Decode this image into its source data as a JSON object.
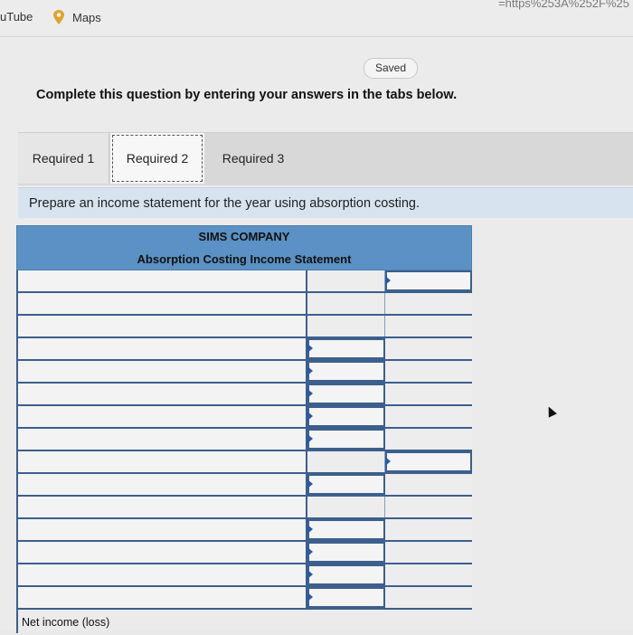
{
  "browser": {
    "url_fragment": "=https%253A%252F%25",
    "bookmarks": [
      {
        "label": "uTube",
        "icon": "youtube"
      },
      {
        "label": "Maps",
        "icon": "map-pin-icon"
      }
    ]
  },
  "status": {
    "saved": "Saved"
  },
  "instruction": "Complete this question by entering your answers in the tabs below.",
  "tabs": [
    {
      "label": "Required 1",
      "active": false
    },
    {
      "label": "Required 2",
      "active": true
    },
    {
      "label": "Required 3",
      "active": false
    }
  ],
  "prompt": "Prepare an income statement for the year using absorption costing.",
  "statement": {
    "company": "SIMS COMPANY",
    "title": "Absorption Costing Income Statement",
    "net_income_label": "Net income (loss)"
  },
  "colors": {
    "header_blue": "#5b91c4",
    "prompt_bg": "#d7e3ef",
    "border_blue": "#3c5f8e"
  }
}
